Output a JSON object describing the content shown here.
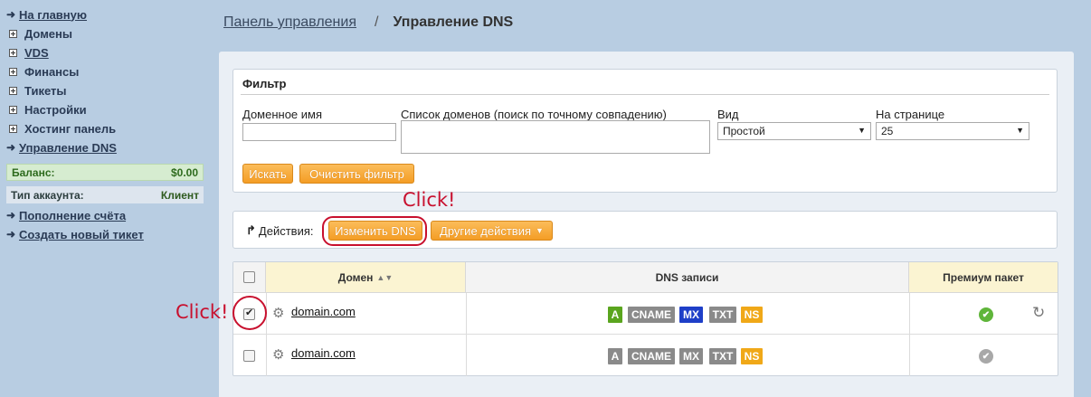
{
  "sidebar": {
    "items": [
      {
        "label": "На главную",
        "icon": "arrow-right-icon"
      },
      {
        "label": "Домены",
        "icon": "plus-box-icon"
      },
      {
        "label": "VDS",
        "icon": "plus-box-icon"
      },
      {
        "label": "Финансы",
        "icon": "plus-box-icon"
      },
      {
        "label": "Тикеты",
        "icon": "plus-box-icon"
      },
      {
        "label": "Настройки",
        "icon": "plus-box-icon"
      },
      {
        "label": "Хостинг панель",
        "icon": "plus-box-icon"
      },
      {
        "label": "Управление DNS",
        "icon": "arrow-right-icon"
      }
    ],
    "balance": {
      "label": "Баланс:",
      "value": "$0.00"
    },
    "account_type": {
      "label": "Тип аккаунта:",
      "value": "Клиент"
    },
    "links": [
      {
        "label": "Пополнение счёта",
        "icon": "arrow-right-icon"
      },
      {
        "label": "Создать новый тикет",
        "icon": "arrow-right-icon"
      }
    ]
  },
  "breadcrumb": {
    "parent": "Панель управления",
    "separator": "/",
    "current": "Управление DNS"
  },
  "filter": {
    "title": "Фильтр",
    "domain_name_label": "Доменное имя",
    "domain_name_value": "",
    "domain_list_label": "Список доменов (поиск по точному совпадению)",
    "domain_list_value": "",
    "view_label": "Вид",
    "view_value": "Простой",
    "per_page_label": "На странице",
    "per_page_value": "25",
    "search_button": "Искать",
    "clear_button": "Очистить фильтр"
  },
  "actions": {
    "label": "Действия:",
    "change_dns_button": "Изменить DNS",
    "other_actions_button": "Другие действия"
  },
  "annotations": {
    "click_text_1": "Click!",
    "click_text_2": "Click!",
    "ring_color": "#c8102e"
  },
  "table": {
    "headers": {
      "domain": "Домен",
      "dns_records": "DNS записи",
      "premium": "Премиум пакет"
    },
    "rows": [
      {
        "checked": true,
        "domain": "domain.com",
        "records": [
          {
            "label": "A",
            "color": "#5aa51e"
          },
          {
            "label": "CNAME",
            "color": "#8a8a8a"
          },
          {
            "label": "MX",
            "color": "#1e3fc8"
          },
          {
            "label": "TXT",
            "color": "#8a8a8a"
          },
          {
            "label": "NS",
            "color": "#f0a818"
          }
        ],
        "premium_status": "active",
        "premium_color": "#5fb53a",
        "has_refresh": true
      },
      {
        "checked": false,
        "domain": "domain.com",
        "records": [
          {
            "label": "A",
            "color": "#8a8a8a"
          },
          {
            "label": "CNAME",
            "color": "#8a8a8a"
          },
          {
            "label": "MX",
            "color": "#8a8a8a"
          },
          {
            "label": "TXT",
            "color": "#8a8a8a"
          },
          {
            "label": "NS",
            "color": "#f0a818"
          }
        ],
        "premium_status": "inactive",
        "premium_color": "#a8a8a8",
        "has_refresh": false
      }
    ]
  }
}
